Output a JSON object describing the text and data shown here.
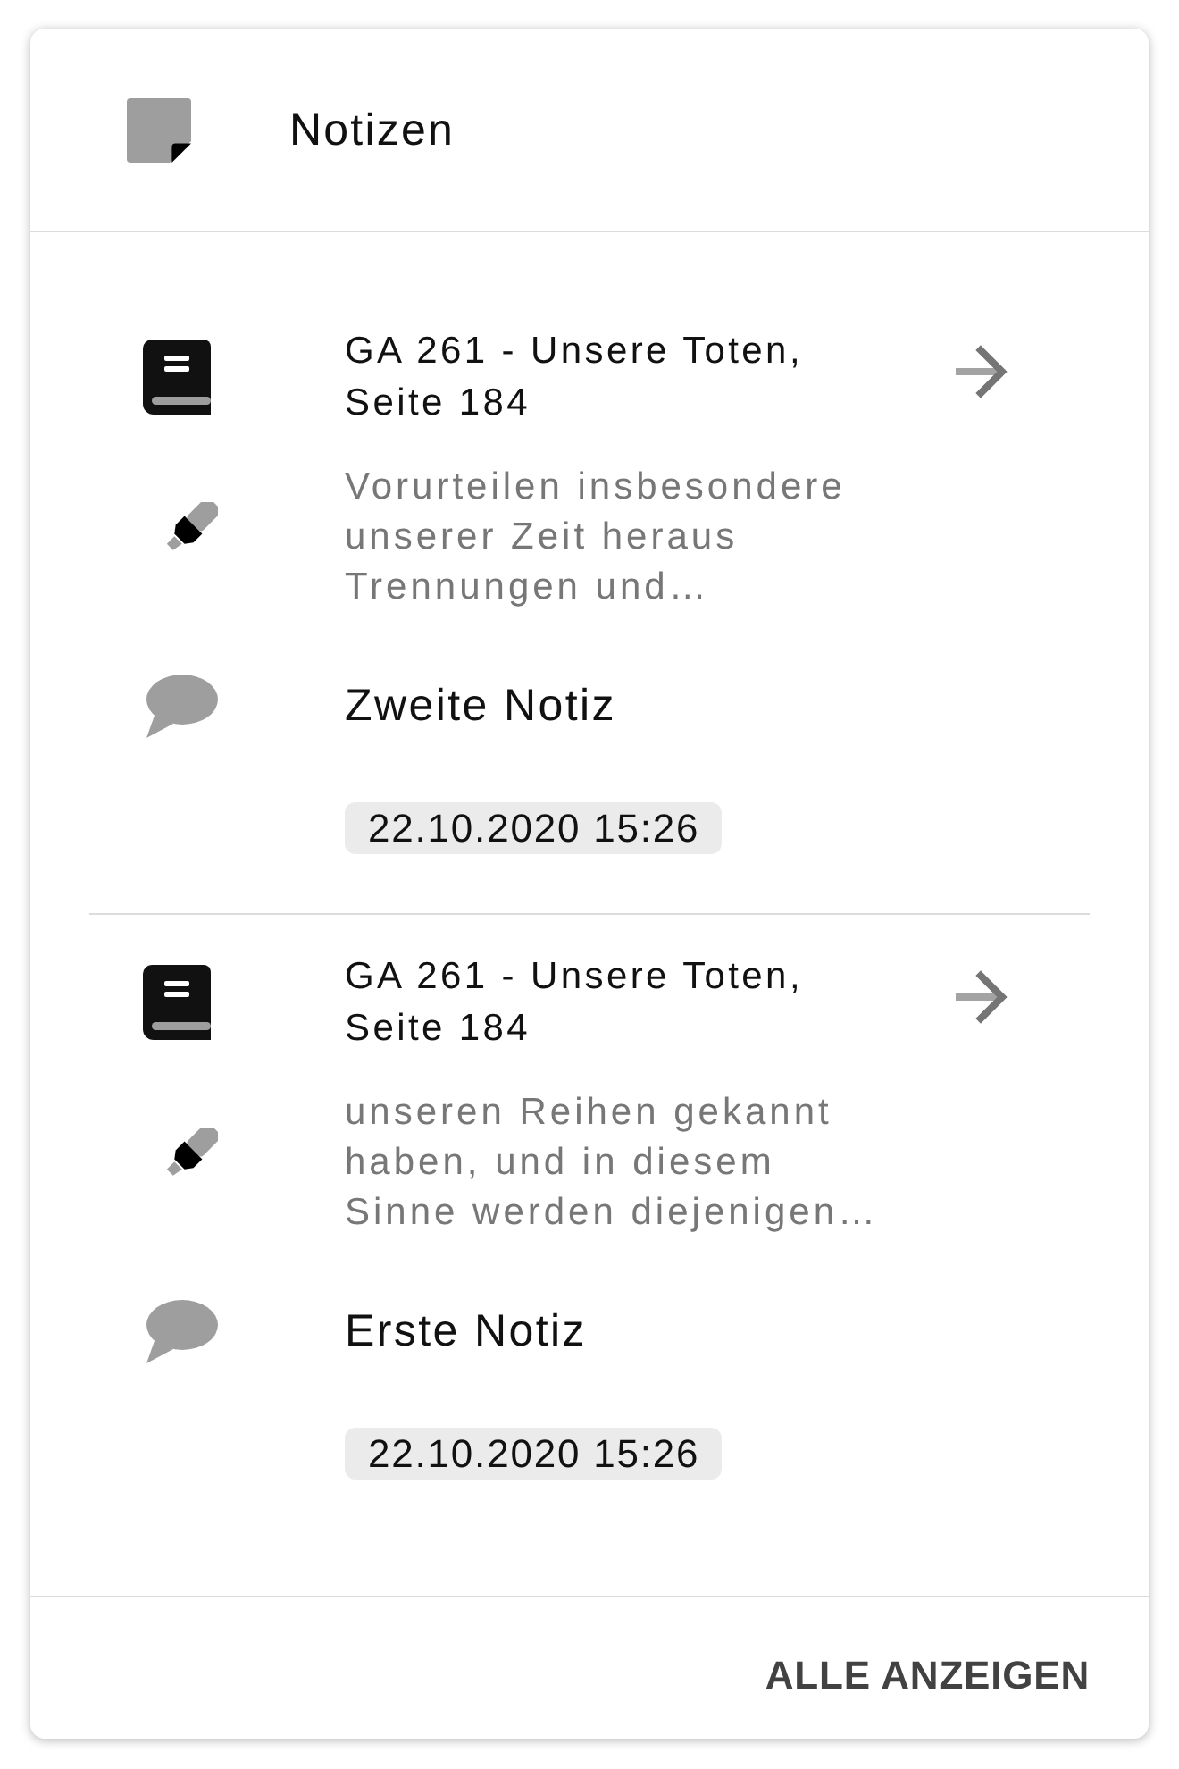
{
  "header": {
    "title": "Notizen"
  },
  "notes": [
    {
      "source": "GA 261 - Unsere Toten, Seite 184",
      "excerpt": "Vorurteilen insbesondere unserer Zeit heraus Trennungen und…",
      "comment": "Zweite Notiz",
      "date": "22.10.2020 15:26"
    },
    {
      "source": "GA 261 - Unsere Toten, Seite 184",
      "excerpt": "unseren Reihen gekannt haben, und in diesem Sinne werden diejenigen…",
      "comment": "Erste Notiz",
      "date": "22.10.2020 15:26"
    }
  ],
  "footer": {
    "action": "ALLE ANZEIGEN"
  }
}
